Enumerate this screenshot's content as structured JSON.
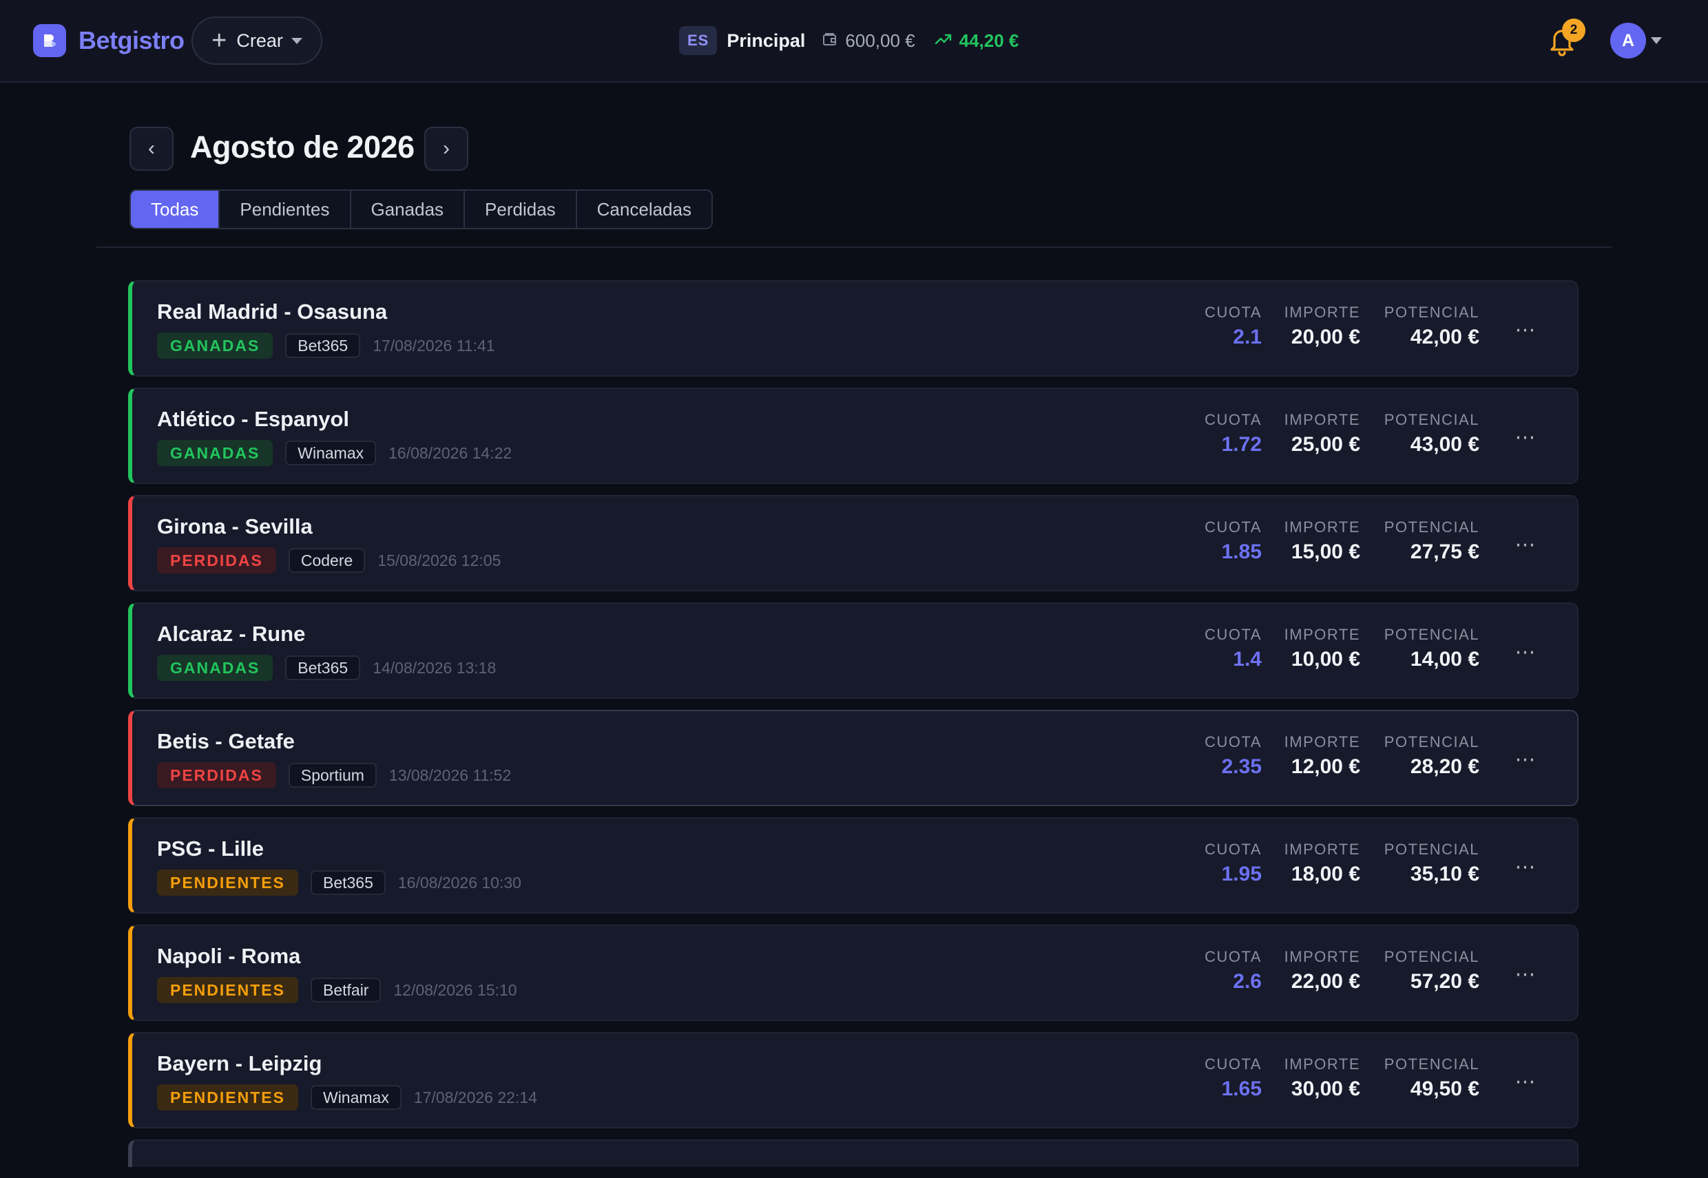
{
  "app": {
    "name": "Betgistro",
    "create_label": "Crear",
    "account": {
      "lang": "ES",
      "name": "Principal",
      "balance": "600,00 €",
      "profit": "44,20 €"
    },
    "notifications_count": "2",
    "user_initial": "A"
  },
  "header": {
    "prev_label": "‹",
    "next_label": "›",
    "month_title": "Agosto de 2026"
  },
  "tabs": [
    {
      "label": "Todas",
      "active": true
    },
    {
      "label": "Pendientes",
      "active": false
    },
    {
      "label": "Ganadas",
      "active": false
    },
    {
      "label": "Perdidas",
      "active": false
    },
    {
      "label": "Canceladas",
      "active": false
    }
  ],
  "stat_labels": {
    "odds": "CUOTA",
    "stake": "IMPORTE",
    "potential": "POTENCIAL"
  },
  "bets": [
    {
      "title": "Real Madrid - Osasuna",
      "status": "GANADAS",
      "status_kind": "won",
      "bookie": "Bet365",
      "date": "17/08/2026 11:41",
      "odds": "2.1",
      "stake": "20,00 €",
      "potential": "42,00 €"
    },
    {
      "title": "Atlético - Espanyol",
      "status": "GANADAS",
      "status_kind": "won",
      "bookie": "Winamax",
      "date": "16/08/2026 14:22",
      "odds": "1.72",
      "stake": "25,00 €",
      "potential": "43,00 €"
    },
    {
      "title": "Girona - Sevilla",
      "status": "PERDIDAS",
      "status_kind": "lost",
      "bookie": "Codere",
      "date": "15/08/2026 12:05",
      "odds": "1.85",
      "stake": "15,00 €",
      "potential": "27,75 €"
    },
    {
      "title": "Alcaraz - Rune",
      "status": "GANADAS",
      "status_kind": "won",
      "bookie": "Bet365",
      "date": "14/08/2026 13:18",
      "odds": "1.4",
      "stake": "10,00 €",
      "potential": "14,00 €"
    },
    {
      "title": "Betis - Getafe",
      "status": "PERDIDAS",
      "status_kind": "lost",
      "bookie": "Sportium",
      "date": "13/08/2026 11:52",
      "odds": "2.35",
      "stake": "12,00 €",
      "potential": "28,20 €"
    },
    {
      "title": "PSG - Lille",
      "status": "PENDIENTES",
      "status_kind": "pending",
      "bookie": "Bet365",
      "date": "16/08/2026 10:30",
      "odds": "1.95",
      "stake": "18,00 €",
      "potential": "35,10 €"
    },
    {
      "title": "Napoli - Roma",
      "status": "PENDIENTES",
      "status_kind": "pending",
      "bookie": "Betfair",
      "date": "12/08/2026 15:10",
      "odds": "2.6",
      "stake": "22,00 €",
      "potential": "57,20 €"
    },
    {
      "title": "Bayern - Leipzig",
      "status": "PENDIENTES",
      "status_kind": "pending",
      "bookie": "Winamax",
      "date": "17/08/2026 22:14",
      "odds": "1.65",
      "stake": "30,00 €",
      "potential": "49,50 €"
    }
  ],
  "colors": {
    "accent": "#6366f1",
    "won": "#22c55e",
    "lost": "#ef4444",
    "pending": "#f59e0b",
    "background": "#0b0e16",
    "card": "#161a2a"
  },
  "icons": {
    "logo": "logo-icon",
    "create": "plus-icon",
    "wallet": "wallet-icon",
    "profit": "trend-up-icon",
    "notifications": "bell-icon",
    "more": "more-horizontal-icon"
  }
}
